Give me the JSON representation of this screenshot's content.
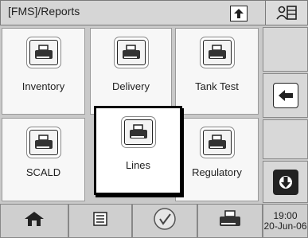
{
  "header": {
    "title": "[FMS]/Reports",
    "title_icon": "home-up-icon",
    "user_icon": "user-list-icon"
  },
  "tiles": [
    {
      "label": "Inventory",
      "icon": "printer-icon"
    },
    {
      "label": "Delivery",
      "icon": "printer-icon"
    },
    {
      "label": "Tank Test",
      "icon": "printer-icon"
    },
    {
      "label": "SCALD",
      "icon": "printer-icon"
    },
    {
      "label": "Lines",
      "icon": "printer-icon",
      "selected": true
    },
    {
      "label": "Regulatory",
      "icon": "printer-icon"
    }
  ],
  "side": {
    "back_icon": "arrow-left-icon",
    "down_icon": "arrow-down-icon"
  },
  "footer": {
    "buttons": [
      "home-icon",
      "list-icon",
      "check-icon",
      "printer-icon"
    ],
    "time": "19:00",
    "date": "20-Jun-06"
  }
}
